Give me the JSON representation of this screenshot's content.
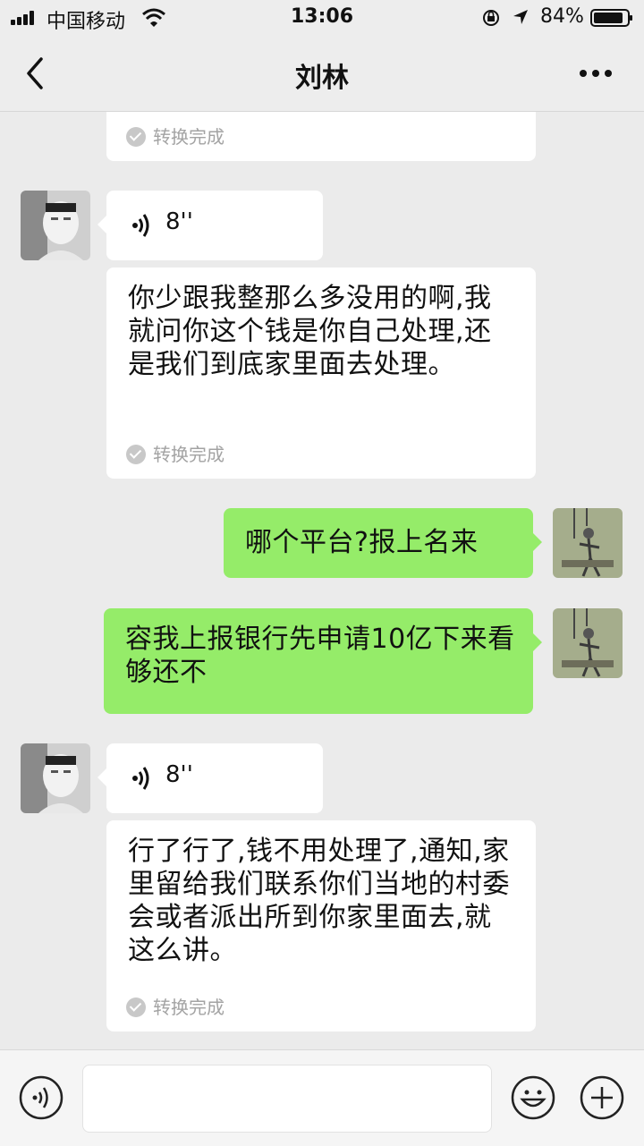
{
  "status_bar": {
    "carrier": "中国移动",
    "time": "13:06",
    "battery": "84%"
  },
  "nav": {
    "title": "刘林",
    "back_icon": "chevron-left-icon",
    "more_icon": "more-icon"
  },
  "chat": {
    "conversion_status": "转换完成",
    "messages": [
      {
        "side": "left",
        "type": "voice",
        "duration": "8''"
      },
      {
        "side": "left",
        "type": "transcript",
        "text": "你少跟我整那么多没用的啊,我就问你这个钱是你自己处理,还是我们到底家里面去处理。"
      },
      {
        "side": "right",
        "type": "text",
        "text": "哪个平台?报上名来"
      },
      {
        "side": "right",
        "type": "text",
        "text": "容我上报银行先申请10亿下来看够还不"
      },
      {
        "side": "left",
        "type": "voice",
        "duration": "8''"
      },
      {
        "side": "left",
        "type": "transcript",
        "text": "行了行了,钱不用处理了,通知,家里留给我们联系你们当地的村委会或者派出所到你家里面去,就这么讲。"
      }
    ]
  },
  "input_bar": {
    "voice_icon": "voice-input-icon",
    "emoji_icon": "emoji-icon",
    "plus_icon": "plus-icon",
    "value": ""
  },
  "colors": {
    "sent_bubble": "#95ec69",
    "received_bubble": "#ffffff",
    "background": "#ebebeb"
  }
}
